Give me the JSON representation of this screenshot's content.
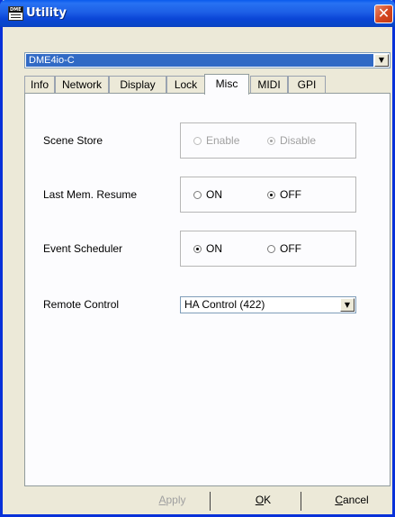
{
  "window": {
    "title": "Utility",
    "app_icon_text": "DME"
  },
  "device_select": {
    "value": "DME4io-C"
  },
  "tabs": [
    {
      "label": "Info"
    },
    {
      "label": "Network"
    },
    {
      "label": "Display"
    },
    {
      "label": "Lock"
    },
    {
      "label": "Misc",
      "active": true
    },
    {
      "label": "MIDI"
    },
    {
      "label": "GPI"
    }
  ],
  "misc": {
    "scene_store": {
      "label": "Scene Store",
      "options": [
        "Enable",
        "Disable"
      ],
      "selected": "Disable",
      "enabled": false
    },
    "last_mem_resume": {
      "label": "Last Mem. Resume",
      "options": [
        "ON",
        "OFF"
      ],
      "selected": "OFF",
      "enabled": true
    },
    "event_scheduler": {
      "label": "Event Scheduler",
      "options": [
        "ON",
        "OFF"
      ],
      "selected": "ON",
      "enabled": true
    },
    "remote_control": {
      "label": "Remote Control",
      "value": "HA Control (422)"
    }
  },
  "buttons": {
    "apply_first": "A",
    "apply_rest": "pply",
    "ok_first": "O",
    "ok_rest": "K",
    "cancel_first": "C",
    "cancel_rest": "ancel"
  }
}
